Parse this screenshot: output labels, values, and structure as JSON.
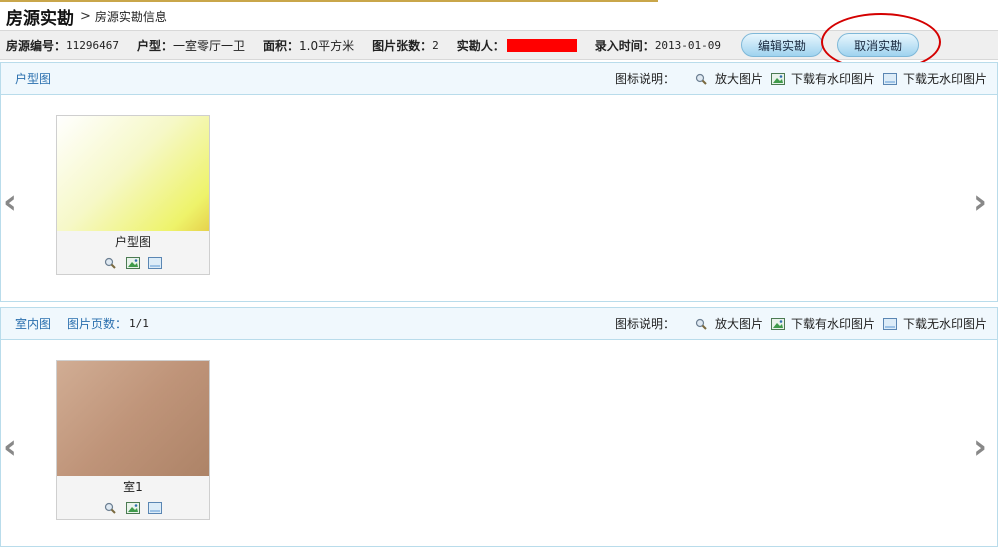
{
  "header": {
    "title": "房源实勘",
    "breadcrumb_sep": ">",
    "breadcrumb": "房源实勘信息"
  },
  "info": {
    "house_no_label": "房源编号：",
    "house_no": "11296467",
    "layout_label": "户型：",
    "layout": "一室零厅一卫",
    "area_label": "面积：",
    "area": "1.0平方米",
    "pic_count_label": "图片张数：",
    "pic_count": "2",
    "surveyor_label": "实勘人：",
    "entry_time_label": "录入时间：",
    "entry_time": "2013-01-09"
  },
  "buttons": {
    "edit": "编辑实勘",
    "cancel": "取消实勘"
  },
  "legend": {
    "label": "图标说明：",
    "zoom": "放大图片",
    "download_wm": "下载有水印图片",
    "download_nowm": "下载无水印图片"
  },
  "sections": [
    {
      "title": "户型图",
      "thumb_label": "户型图"
    },
    {
      "title": "室内图",
      "pages_label": "图片页数：",
      "pages_value": "1/1",
      "thumb_label": "室1"
    }
  ],
  "arrows": {
    "prev": "‹",
    "next": "›"
  },
  "colors": {
    "accent": "#2a6fae",
    "redaction": "#ff0000",
    "circle": "#d40000"
  },
  "icons": [
    "magnifier-icon",
    "picture-watermark-icon",
    "picture-no-watermark-icon",
    "chevron-left-icon",
    "chevron-right-icon"
  ]
}
